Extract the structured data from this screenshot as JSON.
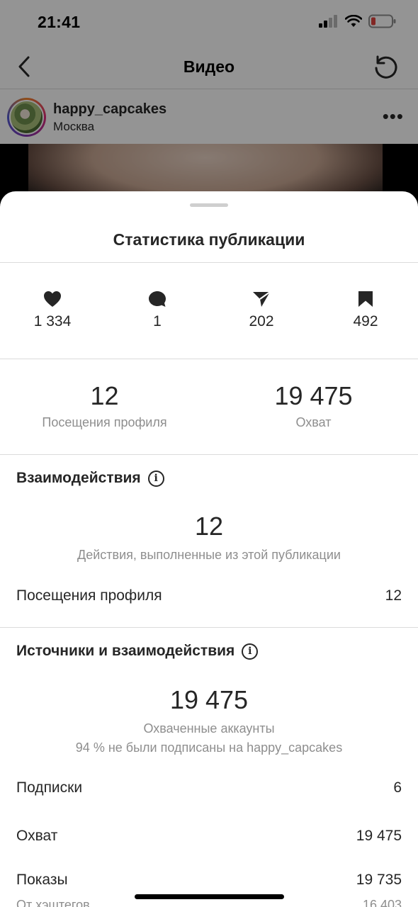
{
  "status_bar": {
    "time": "21:41"
  },
  "nav": {
    "title": "Видео"
  },
  "post": {
    "username": "happy_capcakes",
    "location": "Москва",
    "more": "•••"
  },
  "sheet": {
    "title": "Статистика публикации",
    "metrics": [
      {
        "icon": "heart-icon",
        "value": "1 334"
      },
      {
        "icon": "comment-icon",
        "value": "1"
      },
      {
        "icon": "share-icon",
        "value": "202"
      },
      {
        "icon": "bookmark-icon",
        "value": "492"
      }
    ],
    "summary": [
      {
        "value": "12",
        "label": "Посещения профиля"
      },
      {
        "value": "19 475",
        "label": "Охват"
      }
    ],
    "interactions": {
      "heading": "Взаимодействия",
      "value": "12",
      "caption": "Действия, выполненные из этой публикации",
      "rows": [
        {
          "label": "Посещения профиля",
          "value": "12"
        }
      ]
    },
    "discovery": {
      "heading": "Источники и взаимодействия",
      "value": "19 475",
      "caption": "Охваченные аккаунты",
      "subcaption": "94 % не были подписаны на happy_capcakes",
      "rows": [
        {
          "label": "Подписки",
          "value": "6"
        },
        {
          "label": "Охват",
          "value": "19 475"
        },
        {
          "label": "Показы",
          "value": "19 735"
        },
        {
          "label": "От хэштегов",
          "value": "16 403"
        }
      ]
    }
  },
  "colors": {
    "text": "#262626",
    "muted": "#8e8e8e",
    "divider": "#dbdbdb",
    "battery_low": "#e0443e"
  }
}
